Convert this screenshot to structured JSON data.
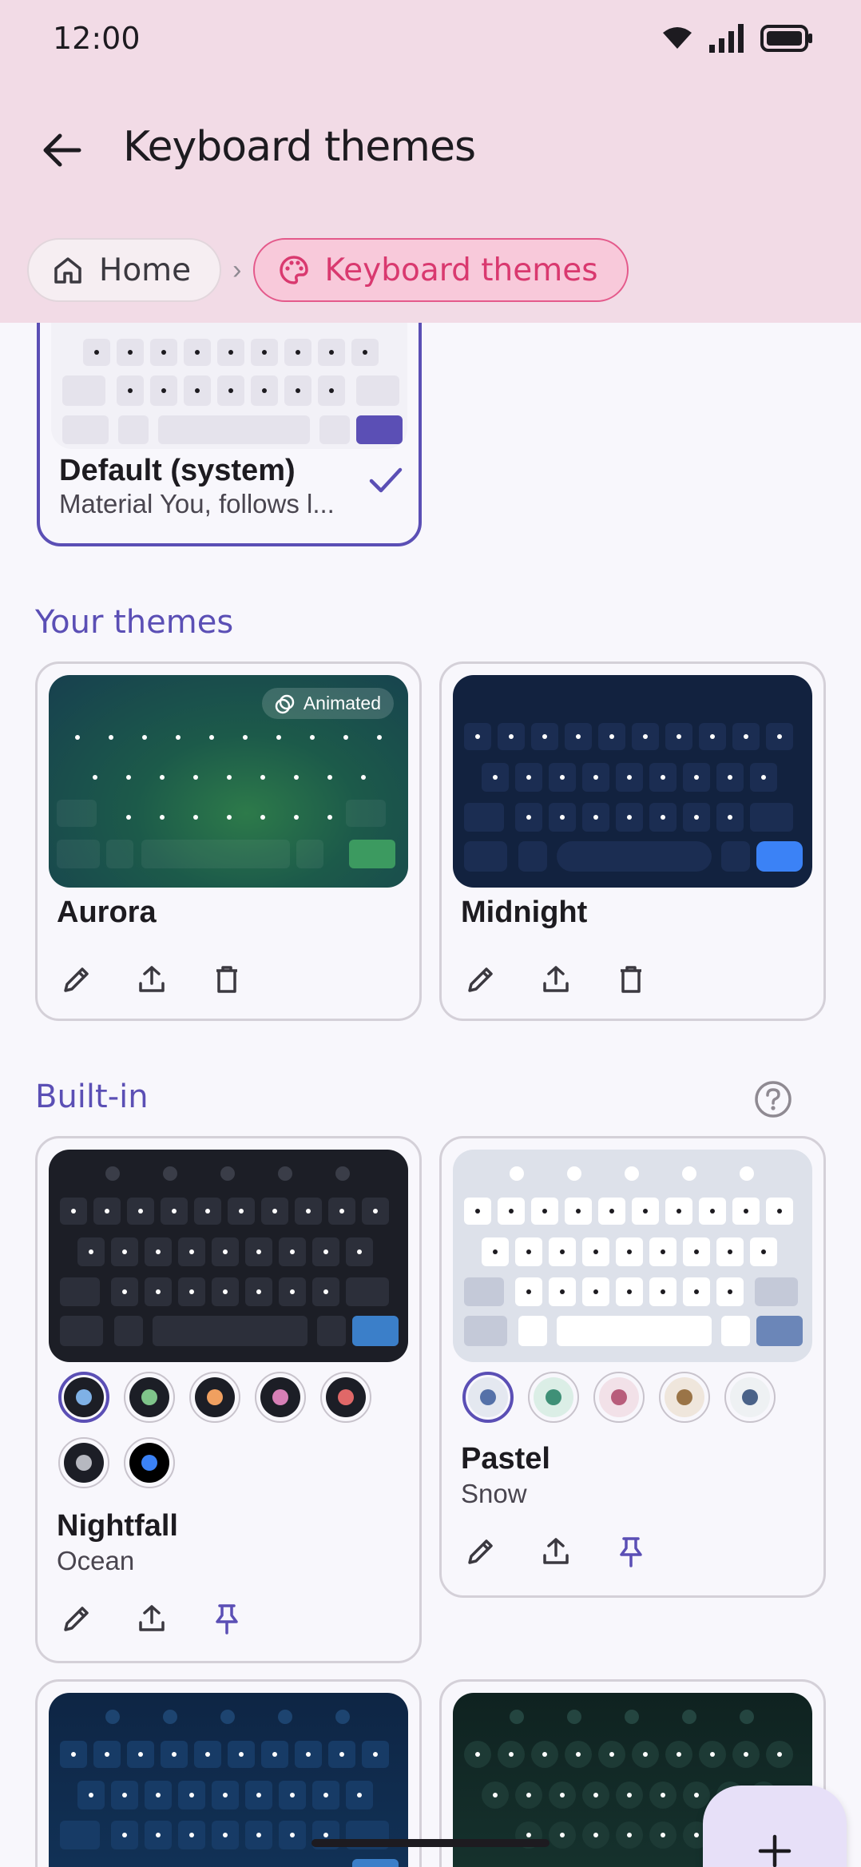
{
  "status": {
    "time": "12:00"
  },
  "appbar": {
    "title": "Keyboard themes"
  },
  "breadcrumb": {
    "home": "Home",
    "current": "Keyboard themes"
  },
  "default_card": {
    "title": "Default (system)",
    "subtitle": "Material You, follows l..."
  },
  "sections": {
    "your_themes": "Your themes",
    "built_in": "Built-in"
  },
  "your_themes": [
    {
      "name": "Aurora",
      "badge": "Animated"
    },
    {
      "name": "Midnight"
    }
  ],
  "built_in": [
    {
      "name": "Nightfall",
      "variant": "Ocean"
    },
    {
      "name": "Pastel",
      "variant": "Snow"
    }
  ],
  "colors": {
    "accent": "#5b4fb5",
    "header_bg": "#f2dbe6",
    "crumb_active": "#d9396f"
  },
  "icons": [
    "back-arrow-icon",
    "home-icon",
    "palette-icon",
    "check-icon",
    "edit-icon",
    "share-icon",
    "delete-icon",
    "pin-icon",
    "help-icon",
    "add-icon",
    "wifi-icon",
    "signal-icon",
    "battery-icon"
  ]
}
